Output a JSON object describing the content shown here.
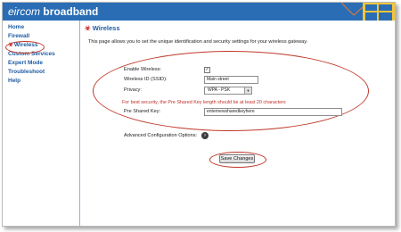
{
  "brand": {
    "part1": "eircom",
    "part2": "broadband"
  },
  "sidebar": {
    "items": [
      {
        "label": "Home"
      },
      {
        "label": "Firewall"
      },
      {
        "label": "Wireless"
      },
      {
        "label": "Custom Services"
      },
      {
        "label": "Expert Mode"
      },
      {
        "label": "Troubleshoot"
      },
      {
        "label": "Help"
      }
    ]
  },
  "main": {
    "title": "Wireless",
    "intro": "This page allows you to set the unique identification and security settings for your wireless gateway.",
    "form": {
      "enable_label": "Enable Wireless:",
      "enable_checked": true,
      "ssid_label": "Wireless ID (SSID):",
      "ssid_value": "Main street",
      "privacy_label": "Privacy:",
      "privacy_value": "WPA - PSK",
      "security_note": "For best security, the Pre Shared Key length should be at least 20 characters",
      "psk_label": "Pre Shared Key:",
      "psk_value": "enternewsharedkeyhere",
      "advanced_label": "Advanced Configuration Options:",
      "save_label": "Save Changes"
    }
  },
  "colors": {
    "header_bg": "#2a6db5",
    "link": "#1e5ba3",
    "highlight_ring": "#c0392b",
    "warning_text": "#c0302b"
  }
}
